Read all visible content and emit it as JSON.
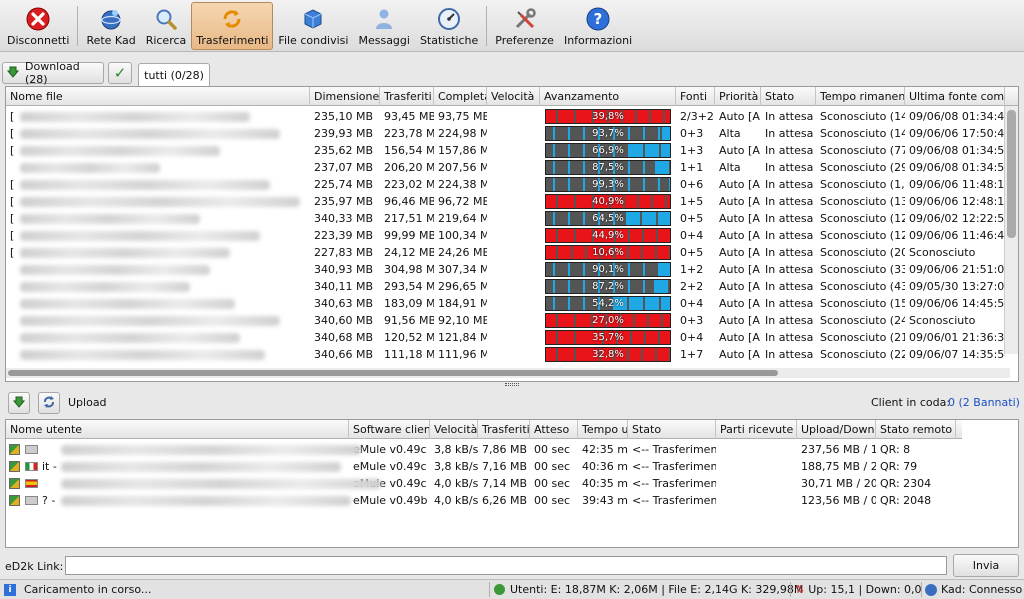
{
  "toolbar": {
    "items": [
      {
        "label": "Disconnetti",
        "icon": "disconnect-icon"
      },
      {
        "label": "Rete Kad",
        "icon": "kad-network-icon"
      },
      {
        "label": "Ricerca",
        "icon": "search-icon"
      },
      {
        "label": "Trasferimenti",
        "icon": "transfers-icon",
        "active": true
      },
      {
        "label": "File condivisi",
        "icon": "shared-files-icon"
      },
      {
        "label": "Messaggi",
        "icon": "messages-icon"
      },
      {
        "label": "Statistiche",
        "icon": "statistics-icon"
      },
      {
        "label": "Preferenze",
        "icon": "preferences-icon"
      },
      {
        "label": "Informazioni",
        "icon": "info-icon"
      }
    ]
  },
  "downloads": {
    "button_label": "Download (28)",
    "tab_label": "tutti (0/28)",
    "columns": [
      "Nome file",
      "Dimensione",
      "Trasferiti",
      "Completati",
      "Velocità",
      "Avanzamento",
      "Fonti",
      "Priorità",
      "Stato",
      "Tempo rimanente",
      "Ultima fonte completa"
    ],
    "rows": [
      {
        "name": "[",
        "size": "235,10 MB",
        "transferred": "93,45 MB",
        "completed": "93,75 MB",
        "speed": "",
        "progress": 39.8,
        "progress_label": "39,8%",
        "sources": "2/3+2",
        "priority": "Auto [A]",
        "status": "In attesa",
        "remaining": "Sconosciuto (14",
        "last_complete": "09/06/08 01:34:46"
      },
      {
        "name": "[",
        "size": "239,93 MB",
        "transferred": "223,78 MB",
        "completed": "224,98 MB",
        "speed": "",
        "progress": 93.7,
        "progress_label": "93,7%",
        "sources": "0+3",
        "priority": "Alta",
        "status": "In attesa",
        "remaining": "Sconosciuto (14",
        "last_complete": "09/06/06 17:50:40"
      },
      {
        "name": "[",
        "size": "235,62 MB",
        "transferred": "156,54 MB",
        "completed": "157,86 MB",
        "speed": "",
        "progress": 66.9,
        "progress_label": "66,9%",
        "sources": "1+3",
        "priority": "Auto [A]",
        "status": "In attesa",
        "remaining": "Sconosciuto (77",
        "last_complete": "09/06/08 01:34:56"
      },
      {
        "name": "",
        "size": "237,07 MB",
        "transferred": "206,20 MB",
        "completed": "207,56 MB",
        "speed": "",
        "progress": 87.5,
        "progress_label": "87,5%",
        "sources": "1+1",
        "priority": "Alta",
        "status": "In attesa",
        "remaining": "Sconosciuto (29",
        "last_complete": "09/06/08 01:34:54"
      },
      {
        "name": "[",
        "size": "225,74 MB",
        "transferred": "223,02 MB",
        "completed": "224,38 MB",
        "speed": "",
        "progress": 99.3,
        "progress_label": "99,3%",
        "sources": "0+6",
        "priority": "Auto [A]",
        "status": "In attesa",
        "remaining": "Sconosciuto (1,",
        "last_complete": "09/06/06 11:48:17"
      },
      {
        "name": "[",
        "size": "235,97 MB",
        "transferred": "96,46 MB",
        "completed": "96,72 MB",
        "speed": "",
        "progress": 40.9,
        "progress_label": "40,9%",
        "sources": "1+5",
        "priority": "Auto [A]",
        "status": "In attesa",
        "remaining": "Sconosciuto (13",
        "last_complete": "09/06/06 12:48:13"
      },
      {
        "name": "[",
        "size": "340,33 MB",
        "transferred": "217,51 MB",
        "completed": "219,64 MB",
        "speed": "",
        "progress": 64.5,
        "progress_label": "64,5%",
        "sources": "0+5",
        "priority": "Auto [A]",
        "status": "In attesa",
        "remaining": "Sconosciuto (12",
        "last_complete": "09/06/02 12:22:52"
      },
      {
        "name": "[",
        "size": "223,39 MB",
        "transferred": "99,99 MB",
        "completed": "100,34 MB",
        "speed": "",
        "progress": 44.9,
        "progress_label": "44,9%",
        "sources": "0+4",
        "priority": "Auto [A]",
        "status": "In attesa",
        "remaining": "Sconosciuto (12",
        "last_complete": "09/06/06 11:46:49"
      },
      {
        "name": "[",
        "size": "227,83 MB",
        "transferred": "24,12 MB",
        "completed": "24,26 MB",
        "speed": "",
        "progress": 10.6,
        "progress_label": "10,6%",
        "sources": "0+5",
        "priority": "Auto [A]",
        "status": "In attesa",
        "remaining": "Sconosciuto (20",
        "last_complete": "Sconosciuto"
      },
      {
        "name": "",
        "size": "340,93 MB",
        "transferred": "304,98 MB",
        "completed": "307,34 MB",
        "speed": "",
        "progress": 90.1,
        "progress_label": "90,1%",
        "sources": "1+2",
        "priority": "Auto [A]",
        "status": "In attesa",
        "remaining": "Sconosciuto (33",
        "last_complete": "09/06/06 21:51:04"
      },
      {
        "name": "",
        "size": "340,11 MB",
        "transferred": "293,54 MB",
        "completed": "296,65 MB",
        "speed": "",
        "progress": 87.2,
        "progress_label": "87,2%",
        "sources": "2+2",
        "priority": "Auto [A]",
        "status": "In attesa",
        "remaining": "Sconosciuto (43",
        "last_complete": "09/05/30 13:27:07"
      },
      {
        "name": "",
        "size": "340,63 MB",
        "transferred": "183,09 MB",
        "completed": "184,91 MB",
        "speed": "",
        "progress": 54.2,
        "progress_label": "54,2%",
        "sources": "0+4",
        "priority": "Auto [A]",
        "status": "In attesa",
        "remaining": "Sconosciuto (15",
        "last_complete": "09/06/06 14:45:58"
      },
      {
        "name": "",
        "size": "340,60 MB",
        "transferred": "91,56 MB",
        "completed": "92,10 MB",
        "speed": "",
        "progress": 27.0,
        "progress_label": "27,0%",
        "sources": "0+3",
        "priority": "Auto [A]",
        "status": "In attesa",
        "remaining": "Sconosciuto (24",
        "last_complete": "Sconosciuto"
      },
      {
        "name": "",
        "size": "340,68 MB",
        "transferred": "120,52 MB",
        "completed": "121,84 MB",
        "speed": "",
        "progress": 35.7,
        "progress_label": "35,7%",
        "sources": "0+4",
        "priority": "Auto [A]",
        "status": "In attesa",
        "remaining": "Sconosciuto (21",
        "last_complete": "09/06/01 21:36:34"
      },
      {
        "name": "",
        "size": "340,66 MB",
        "transferred": "111,18 MB",
        "completed": "111,96 MB",
        "speed": "",
        "progress": 32.8,
        "progress_label": "32,8%",
        "sources": "1+7",
        "priority": "Auto [A]",
        "status": "In attesa",
        "remaining": "Sconosciuto (22",
        "last_complete": "09/06/07 14:35:54"
      }
    ]
  },
  "uploads": {
    "label": "Upload",
    "queue_label": "Client in coda:",
    "queue_value": "0 (2 Bannati)",
    "columns": [
      "Nome utente",
      "Software client",
      "Velocità",
      "Trasferiti",
      "Atteso",
      "Tempo upload",
      "Stato",
      "Parti ricevute",
      "Upload/Download",
      "Stato remoto"
    ],
    "rows": [
      {
        "user": "",
        "software": "eMule v0.49c",
        "speed": "3,8 kB/s",
        "transferred": "7,86 MB",
        "waited": "00 sec",
        "time": "42:35 m",
        "status": "<-- Trasferimento",
        "parts": "",
        "updown": "237,56 MB / 16",
        "remote": "QR: 8",
        "flag": ""
      },
      {
        "user": "it -",
        "software": "eMule v0.49c",
        "speed": "3,8 kB/s",
        "transferred": "7,16 MB",
        "waited": "00 sec",
        "time": "40:36 m",
        "status": "<-- Trasferimento",
        "parts": "",
        "updown": "188,75 MB / 23",
        "remote": "QR: 79",
        "flag": "it"
      },
      {
        "user": "",
        "software": "eMule v0.49c",
        "speed": "4,0 kB/s",
        "transferred": "7,14 MB",
        "waited": "00 sec",
        "time": "40:35 m",
        "status": "<-- Trasferimento",
        "parts": "",
        "updown": "30,71 MB / 20,",
        "remote": "QR: 2304",
        "flag": "es"
      },
      {
        "user": "? -",
        "software": "eMule v0.49b",
        "speed": "4,0 kB/s",
        "transferred": "6,26 MB",
        "waited": "00 sec",
        "time": "39:43 m",
        "status": "<-- Trasferimento",
        "parts": "",
        "updown": "123,56 MB / 0",
        "remote": "QR: 2048",
        "flag": ""
      }
    ]
  },
  "ed2k": {
    "label": "eD2k Link:",
    "value": "",
    "button": "Invia"
  },
  "status_bar": {
    "message": "Caricamento in corso...",
    "users": "Utenti: E: 18,87M K: 2,06M | File E: 2,14G K: 329,98M",
    "speed": "Up: 15,1 | Down: 0,0",
    "kad": "Kad: Connesso"
  },
  "colors": {
    "accent": "#e8b886",
    "progress_blue": "#1fa8e6",
    "progress_red": "#e8141a",
    "progress_gray": "#555555"
  }
}
